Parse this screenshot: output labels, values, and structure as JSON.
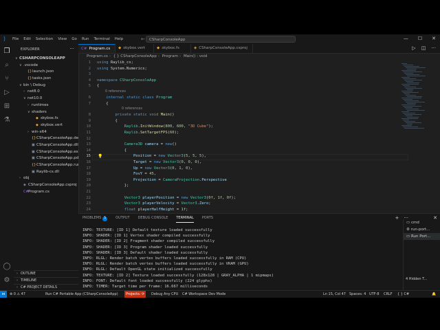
{
  "titlebar": {
    "menu": [
      "File",
      "Edit",
      "Selection",
      "View",
      "Go",
      "Run",
      "Terminal",
      "Help"
    ],
    "search_text": "CSharpConsoleApp"
  },
  "sidebar": {
    "title": "EXPLORER",
    "tree": [
      {
        "label": "CSHARPCONSOLEAPP",
        "chev": "∨",
        "icon": "",
        "indent": 0,
        "bold": true
      },
      {
        "label": ".vscode",
        "chev": "∨",
        "icon": "",
        "indent": 1
      },
      {
        "label": "launch.json",
        "chev": "",
        "icon": "{}",
        "indent": 2
      },
      {
        "label": "tasks.json",
        "chev": "",
        "icon": "{}",
        "indent": 2
      },
      {
        "label": "bin \\ Debug",
        "chev": "∨",
        "icon": "",
        "indent": 1
      },
      {
        "label": "net8.0",
        "chev": "›",
        "icon": "",
        "indent": 2
      },
      {
        "label": "net10.0",
        "chev": "∨",
        "icon": "",
        "indent": 2
      },
      {
        "label": "runtimes",
        "chev": "›",
        "icon": "",
        "indent": 3
      },
      {
        "label": "shaders",
        "chev": "∨",
        "icon": "",
        "indent": 3
      },
      {
        "label": "skybox.fs",
        "chev": "",
        "icon": "◆",
        "indent": 4
      },
      {
        "label": "skybox.vert",
        "chev": "",
        "icon": "◆",
        "indent": 4
      },
      {
        "label": "win-x64",
        "chev": "›",
        "icon": "",
        "indent": 3
      },
      {
        "label": "CSharpConsoleApp.deps...",
        "chev": "",
        "icon": "{}",
        "indent": 3
      },
      {
        "label": "CSharpConsoleApp.dll",
        "chev": "",
        "icon": "▣",
        "indent": 3
      },
      {
        "label": "CSharpConsoleApp.exe",
        "chev": "",
        "icon": "▣",
        "indent": 3
      },
      {
        "label": "CSharpConsoleApp.pdb",
        "chev": "",
        "icon": "▣",
        "indent": 3
      },
      {
        "label": "CSharpConsoleApp.runti...",
        "chev": "",
        "icon": "{}",
        "indent": 3
      },
      {
        "label": "Raylib-cs.dll",
        "chev": "",
        "icon": "▣",
        "indent": 3
      },
      {
        "label": "obj",
        "chev": "›",
        "icon": "",
        "indent": 1
      },
      {
        "label": "CSharpConsoleApp.csproj",
        "chev": "",
        "icon": "◈",
        "indent": 1
      },
      {
        "label": "Program.cs",
        "chev": "",
        "icon": "C#",
        "indent": 1
      }
    ],
    "bottom": [
      "OUTLINE",
      "TIMELINE",
      "C# PROJECT DETAILS"
    ]
  },
  "tabs": [
    {
      "label": "Program.cs",
      "icon": "C#",
      "active": true
    },
    {
      "label": "skybox.vert",
      "icon": "◆",
      "active": false
    },
    {
      "label": "skybox.fs",
      "icon": "◆",
      "active": false
    },
    {
      "label": "CSharpConsoleApp.csproj",
      "icon": "◈",
      "active": false
    }
  ],
  "breadcrumb": [
    "Program.cs",
    "{ } CSharpConsoleApp",
    "Program",
    "Main() : void"
  ],
  "code_lines": [
    {
      "n": "1",
      "html": "<span class='kw'>using</span> Raylib_cs;"
    },
    {
      "n": "2",
      "html": "<span class='kw'>using</span> System.Numerics;"
    },
    {
      "n": "3",
      "html": ""
    },
    {
      "n": "4",
      "html": "<span class='kw'>namespace</span> <span class='ty'>CSharpConsoleApp</span>"
    },
    {
      "n": "5",
      "html": "{"
    },
    {
      "hint": "0 references",
      "indent": 2
    },
    {
      "n": "6",
      "html": "    <span class='kw'>internal</span> <span class='kw'>static</span> <span class='kw'>class</span> <span class='ty'>Program</span>"
    },
    {
      "n": "7",
      "html": "    {"
    },
    {
      "hint": "0 references",
      "indent": 6
    },
    {
      "n": "8",
      "html": "        <span class='kw'>private</span> <span class='kw'>static</span> <span class='kw'>void</span> <span class='fn'>Main</span>()"
    },
    {
      "n": "9",
      "html": "        {"
    },
    {
      "n": "10",
      "html": "            <span class='ty'>Raylib</span>.<span class='fn'>InitWindow</span>(<span class='num'>800</span>, <span class='num'>600</span>, <span class='str'>\"3D Cube\"</span>);"
    },
    {
      "n": "11",
      "html": "            <span class='ty'>Raylib</span>.<span class='fn'>SetTargetFPS</span>(<span class='num'>60</span>);"
    },
    {
      "n": "12",
      "html": ""
    },
    {
      "n": "13",
      "html": "            <span class='ty'>Camera3D</span> <span class='var'>camera</span> = <span class='kw'>new</span>()"
    },
    {
      "n": "14",
      "html": "            {"
    },
    {
      "n": "15",
      "html": "                <span class='var'>Position</span> = <span class='kw'>new</span> <span class='ty'>Vector3</span>(<span class='num'>5</span>, <span class='num'>5</span>, <span class='num'>5</span>),",
      "cur": true
    },
    {
      "n": "16",
      "html": "                <span class='var'>Target</span> = <span class='kw'>new</span> <span class='ty'>Vector3</span>(<span class='num'>0</span>, <span class='num'>0</span>, <span class='num'>0</span>),"
    },
    {
      "n": "17",
      "html": "                <span class='var'>Up</span> = <span class='kw'>new</span> <span class='ty'>Vector3</span>(<span class='num'>0</span>, <span class='num'>1</span>, <span class='num'>0</span>),"
    },
    {
      "n": "18",
      "html": "                <span class='var'>FovY</span> = <span class='num'>45</span>,"
    },
    {
      "n": "19",
      "html": "                <span class='var'>Projection</span> = <span class='ty'>CameraProjection</span>.<span class='var'>Perspective</span>"
    },
    {
      "n": "20",
      "html": "            };"
    },
    {
      "n": "21",
      "html": ""
    },
    {
      "n": "22",
      "html": "            <span class='ty'>Vector3</span> <span class='var'>playerPosition</span> = <span class='kw'>new</span> <span class='ty'>Vector3</span>(<span class='num'>0f</span>, <span class='num'>1f</span>, <span class='num'>0f</span>);"
    },
    {
      "n": "23",
      "html": "            <span class='ty'>Vector3</span> <span class='var'>playerVelocity</span> = <span class='ty'>Vector3</span>.<span class='var'>Zero</span>;"
    },
    {
      "n": "24",
      "html": "            <span class='kw'>float</span> <span class='var'>playerHalfHeight</span> = <span class='num'>1f</span>;"
    }
  ],
  "panel": {
    "tabs": [
      "PROBLEMS",
      "OUTPUT",
      "DEBUG CONSOLE",
      "TERMINAL",
      "PORTS"
    ],
    "active_tab": "TERMINAL",
    "problems_count": "5",
    "terminal_lines": [
      "INFO: TEXTURE: [ID 1] Default texture loaded successfully",
      "INFO: SHADER: [ID 1] Vertex shader compiled successfully",
      "INFO: SHADER: [ID 2] Fragment shader compiled successfully",
      "INFO: SHADER: [ID 3] Program shader loaded successfully",
      "INFO: SHADER: [ID 3] Default shader loaded successfully",
      "INFO: RLGL: Render batch vertex buffers loaded successfully in RAM (CPU)",
      "INFO: RLGL: Render batch vertex buffers loaded successfully in VRAM (GPU)",
      "INFO: RLGL: Default OpenGL state initialized successfully",
      "INFO: TEXTURE: [ID 2] Texture loaded successfully (128x128 | GRAY_ALPHA | 1 mipmaps)",
      "INFO: FONT: Default font loaded successfully (224 glyphs)",
      "INFO: TIMER: Target time per frame: 16.667 milliseconds"
    ],
    "terminals": [
      "cmd",
      "run-port...",
      "Run Port..."
    ],
    "hidden_terminals": "4 Hidden T..."
  },
  "status": {
    "errors": "⊗ 0 ⚠ 47",
    "run": "Run C# Portable App (CSharpConsoleApp)",
    "projects": "Projects: ⟳",
    "debug": "Debug Any CPU",
    "workspace": "C# Workspace Dev Mode",
    "position": "Ln 15, Col 47",
    "spaces": "Spaces: 4",
    "encoding": "UTF-8",
    "eol": "CRLF",
    "language": "{ } C#"
  }
}
